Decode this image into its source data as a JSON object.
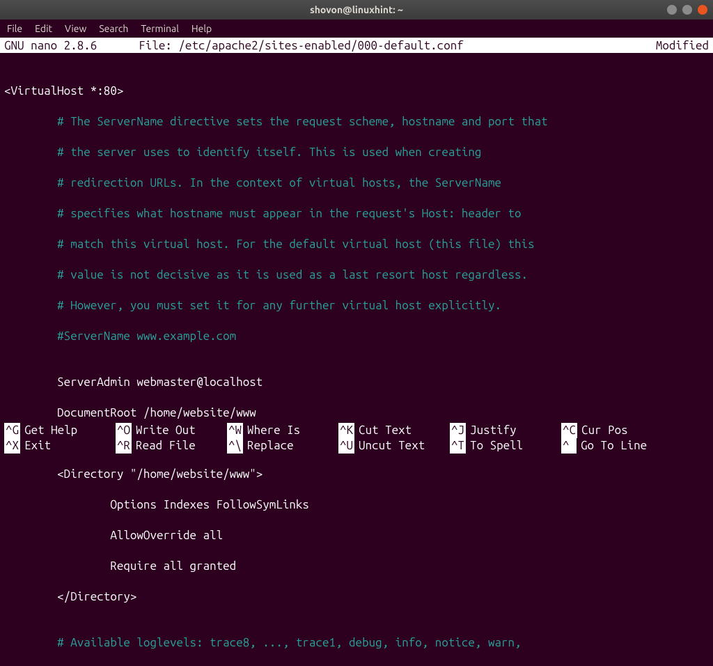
{
  "window": {
    "title": "shovon@linuxhint: ~"
  },
  "menubar": {
    "file": "File",
    "edit": "Edit",
    "view": "View",
    "search": "Search",
    "terminal": "Terminal",
    "help": "Help"
  },
  "nano_header": {
    "version": "  GNU nano 2.8.6",
    "file_label": "File: /etc/apache2/sites-enabled/000-default.conf",
    "status": "Modified  "
  },
  "content": {
    "l01": "<VirtualHost *:80>",
    "l02": "        # The ServerName directive sets the request scheme, hostname and port that",
    "l03": "        # the server uses to identify itself. This is used when creating",
    "l04": "        # redirection URLs. In the context of virtual hosts, the ServerName",
    "l05": "        # specifies what hostname must appear in the request's Host: header to",
    "l06": "        # match this virtual host. For the default virtual host (this file) this",
    "l07": "        # value is not decisive as it is used as a last resort host regardless.",
    "l08": "        # However, you must set it for any further virtual host explicitly.",
    "l09": "        #ServerName www.example.com",
    "l10": "",
    "l11": "        ServerAdmin webmaster@localhost",
    "l12": "        DocumentRoot /home/website/www",
    "l13": "",
    "l14": "",
    "l15": "        <Directory \"/home/website/www\">",
    "l16": "                Options Indexes FollowSymLinks",
    "l17": "                AllowOverride all",
    "l18": "                Require all granted",
    "l19": "        </Directory>",
    "l20": "",
    "l21": "        # Available loglevels: trace8, ..., trace1, debug, info, notice, warn,"
  },
  "shortcuts": {
    "r1": {
      "k1": "^G",
      "d1": "Get Help",
      "k2": "^O",
      "d2": "Write Out",
      "k3": "^W",
      "d3": "Where Is",
      "k4": "^K",
      "d4": "Cut Text",
      "k5": "^J",
      "d5": "Justify",
      "k6": "^C",
      "d6": "Cur Pos"
    },
    "r2": {
      "k1": "^X",
      "d1": "Exit",
      "k2": "^R",
      "d2": "Read File",
      "k3": "^\\",
      "d3": "Replace",
      "k4": "^U",
      "d4": "Uncut Text",
      "k5": "^T",
      "d5": "To Spell",
      "k6": "^ ",
      "d6": "Go To Line"
    }
  }
}
